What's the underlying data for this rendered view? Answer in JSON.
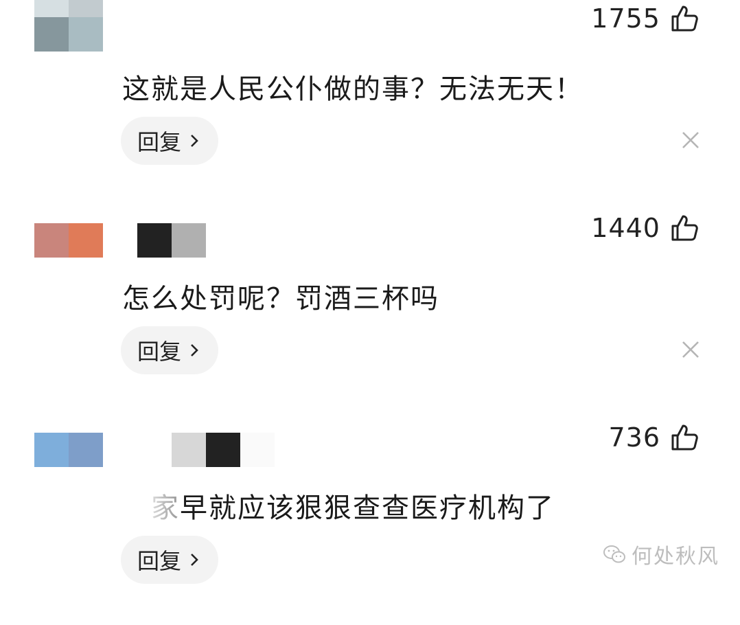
{
  "comments": [
    {
      "likes": "1755",
      "text": "这就是人民公仆做的事？无法无天！",
      "reply_label": "回复",
      "avatar_colors": [
        "#d6dfe2",
        "#c2cbcf",
        "#86979d",
        "#a9bcc2"
      ],
      "name_colors": []
    },
    {
      "likes": "1440",
      "text": "怎么处罚呢？罚酒三杯吗",
      "reply_label": "回复",
      "avatar_colors": [
        "#c9857c",
        "#e07b58"
      ],
      "name_colors": [
        "#222222",
        "#b0b0b0"
      ]
    },
    {
      "likes": "736",
      "text": "家早就应该狠狠查查医疗机构了",
      "reply_label": "回复",
      "avatar_colors": [
        "#7eaedb",
        "#7e9ec9"
      ],
      "name_colors": [
        "#d7d7d7",
        "#222222",
        "#fafafa"
      ]
    }
  ],
  "watermark": "何处秋风",
  "colors": {
    "reply_bg": "#f3f3f3",
    "text": "#1a1a1a",
    "icon": "#222222"
  }
}
